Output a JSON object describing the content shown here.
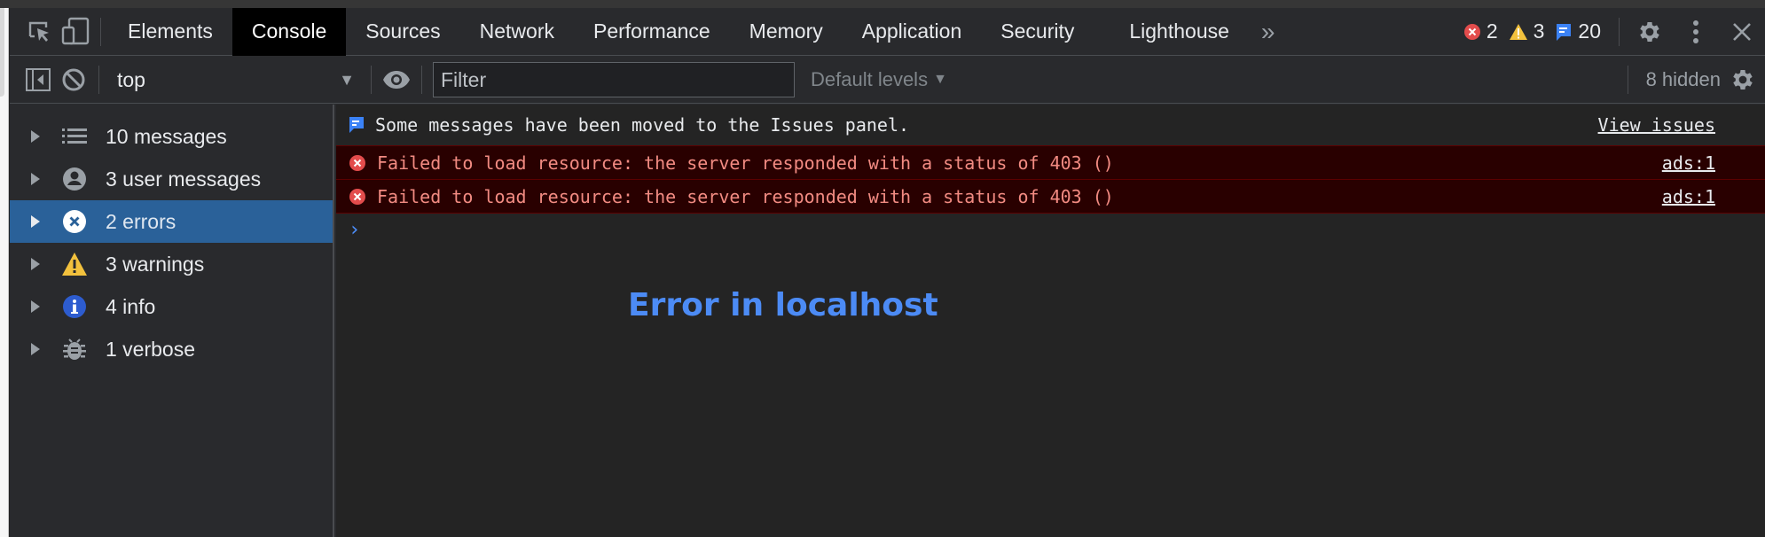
{
  "tabs": [
    {
      "label": "Elements",
      "active": false
    },
    {
      "label": "Console",
      "active": true
    },
    {
      "label": "Sources",
      "active": false
    },
    {
      "label": "Network",
      "active": false
    },
    {
      "label": "Performance",
      "active": false
    },
    {
      "label": "Memory",
      "active": false
    },
    {
      "label": "Application",
      "active": false
    },
    {
      "label": "Security",
      "active": false
    },
    {
      "label": "Lighthouse",
      "active": false
    }
  ],
  "more_tabs_label": "»",
  "counters": {
    "errors": "2",
    "warnings": "3",
    "issues": "20"
  },
  "toolbar": {
    "context": "top",
    "filter_placeholder": "Filter",
    "filter_value": "",
    "levels": "Default levels",
    "hidden": "8 hidden"
  },
  "sidebar": {
    "items": [
      {
        "label": "10 messages",
        "icon": "list-icon"
      },
      {
        "label": "3 user messages",
        "icon": "user-icon"
      },
      {
        "label": "2 errors",
        "icon": "error-icon",
        "selected": true
      },
      {
        "label": "3 warnings",
        "icon": "warning-icon"
      },
      {
        "label": "4 info",
        "icon": "info-icon"
      },
      {
        "label": "1 verbose",
        "icon": "bug-icon"
      }
    ]
  },
  "console": {
    "issues_message": "Some messages have been moved to the Issues panel.",
    "issues_link": "View issues",
    "errors": [
      {
        "text": "Failed to load resource: the server responded with a status of 403 ()",
        "source": "ads:1"
      },
      {
        "text": "Failed to load resource: the server responded with a status of 403 ()",
        "source": "ads:1"
      }
    ],
    "prompt": "›"
  },
  "overlay_text": "Error in localhost",
  "colors": {
    "selected": "#2a6199",
    "error_bg": "#290000",
    "error_text": "#f28b82",
    "accent": "#4c8bf5"
  }
}
